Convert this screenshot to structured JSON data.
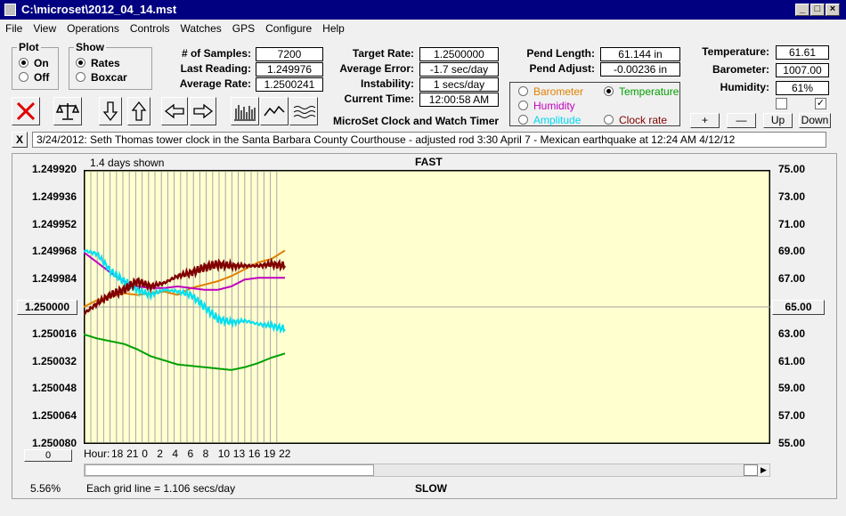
{
  "window": {
    "title": "C:\\microset\\2012_04_14.mst"
  },
  "menu": [
    "File",
    "View",
    "Operations",
    "Controls",
    "Watches",
    "GPS",
    "Configure",
    "Help"
  ],
  "plot_group": {
    "label": "Plot",
    "on": "On",
    "off": "Off"
  },
  "show_group": {
    "label": "Show",
    "rates": "Rates",
    "boxcar": "Boxcar"
  },
  "stats": {
    "samples_label": "# of Samples:",
    "samples": "7200",
    "last_label": "Last Reading:",
    "last": "1.249976",
    "avg_rate_label": "Average Rate:",
    "avg_rate": "1.2500241"
  },
  "target": {
    "target_label": "Target Rate:",
    "target": "1.2500000",
    "error_label": "Average Error:",
    "error": "-1.7 sec/day",
    "instab_label": "Instability:",
    "instab": "1 secs/day",
    "time_label": "Current Time:",
    "time": "12:00:58 AM"
  },
  "pend": {
    "length_label": "Pend Length:",
    "length": "61.144 in",
    "adjust_label": "Pend Adjust:",
    "adjust": "-0.00236 in"
  },
  "env": {
    "temp_label": "Temperature:",
    "temp": "61.61",
    "baro_label": "Barometer:",
    "baro": "1007.00",
    "hum_label": "Humidity:",
    "hum": "61%"
  },
  "sensor_options": {
    "barometer": "Barometer",
    "temperature": "Temperature",
    "humidity": "Humidity",
    "amplitude": "Amplitude",
    "clock_rate": "Clock rate"
  },
  "colors": {
    "barometer": "#e08000",
    "temperature": "#00a000",
    "humidity": "#c000c0",
    "amplitude": "#00e0f0",
    "clock_rate": "#800000"
  },
  "pm_buttons": {
    "plus": "+",
    "minus": "—",
    "up": "Up",
    "down": "Down"
  },
  "app_caption": "MicroSet Clock and Watch Timer",
  "note": {
    "close": "X",
    "text": "3/24/2012: Seth Thomas tower clock in the Santa Barbara County Courthouse - adjusted rod 3:30 April 7 - Mexican earthquake at 12:24 AM 4/12/12"
  },
  "chart": {
    "days_shown": "1.4 days shown",
    "fast": "FAST",
    "slow": "SLOW",
    "left_ticks": [
      "1.249920",
      "1.249936",
      "1.249952",
      "1.249968",
      "1.249984",
      "",
      "1.250016",
      "1.250032",
      "1.250048",
      "1.250064",
      "1.250080"
    ],
    "left_center": "1.250000",
    "right_ticks": [
      "75.00",
      "73.00",
      "71.00",
      "69.00",
      "67.00",
      "",
      "63.00",
      "61.00",
      "59.00",
      "57.00",
      "55.00"
    ],
    "right_center": "65.00",
    "hour_label": "Hour:",
    "hours": [
      "18",
      "21",
      "0",
      "2",
      "4",
      "6",
      "8",
      "10",
      "13",
      "16",
      "19",
      "22"
    ],
    "left_bottom_btn": "0",
    "percent": "5.56%",
    "grid_note": "Each grid line = 1.106 secs/day"
  },
  "chart_data": {
    "type": "line",
    "left_axis": {
      "ylim": [
        1.24992,
        1.25008
      ],
      "inverted": true
    },
    "right_axis": {
      "ylim": [
        55,
        75
      ]
    },
    "series": [
      {
        "name": "Barometer",
        "color": "#e08000",
        "axis": "left",
        "values": [
          1.25,
          1.249996,
          1.249994,
          1.249992,
          1.249993,
          1.249992,
          1.249991,
          1.249993,
          1.249989,
          1.249987,
          1.249985,
          1.249982,
          1.249978,
          1.249974,
          1.249972,
          1.249967
        ]
      },
      {
        "name": "Temperature",
        "color": "#00a000",
        "axis": "right",
        "values": [
          63.0,
          62.7,
          62.5,
          62.3,
          61.9,
          61.4,
          61.1,
          60.8,
          60.7,
          60.6,
          60.5,
          60.4,
          60.6,
          60.9,
          61.3,
          61.6
        ]
      },
      {
        "name": "Humidity",
        "color": "#c000c0",
        "axis": "left",
        "values": [
          1.249968,
          1.249974,
          1.24998,
          1.249985,
          1.249988,
          1.249989,
          1.249989,
          1.249988,
          1.249989,
          1.24999,
          1.24999,
          1.249988,
          1.249984,
          1.249983,
          1.249983,
          1.249983
        ]
      },
      {
        "name": "Amplitude",
        "color": "#00e0f0",
        "axis": "left",
        "values": [
          1.249967,
          1.249969,
          1.249979,
          1.249985,
          1.24999,
          1.249993,
          1.24999,
          1.249991,
          1.249993,
          1.25,
          1.250007,
          1.250009,
          1.250008,
          1.25001,
          1.250011,
          1.250013
        ]
      },
      {
        "name": "Clock rate",
        "color": "#800000",
        "axis": "left",
        "values": [
          1.250004,
          1.249998,
          1.249993,
          1.24999,
          1.249985,
          1.249988,
          1.249986,
          1.249982,
          1.24998,
          1.249977,
          1.249975,
          1.249976,
          1.249976,
          1.249976,
          1.249975,
          1.249976
        ]
      }
    ]
  }
}
